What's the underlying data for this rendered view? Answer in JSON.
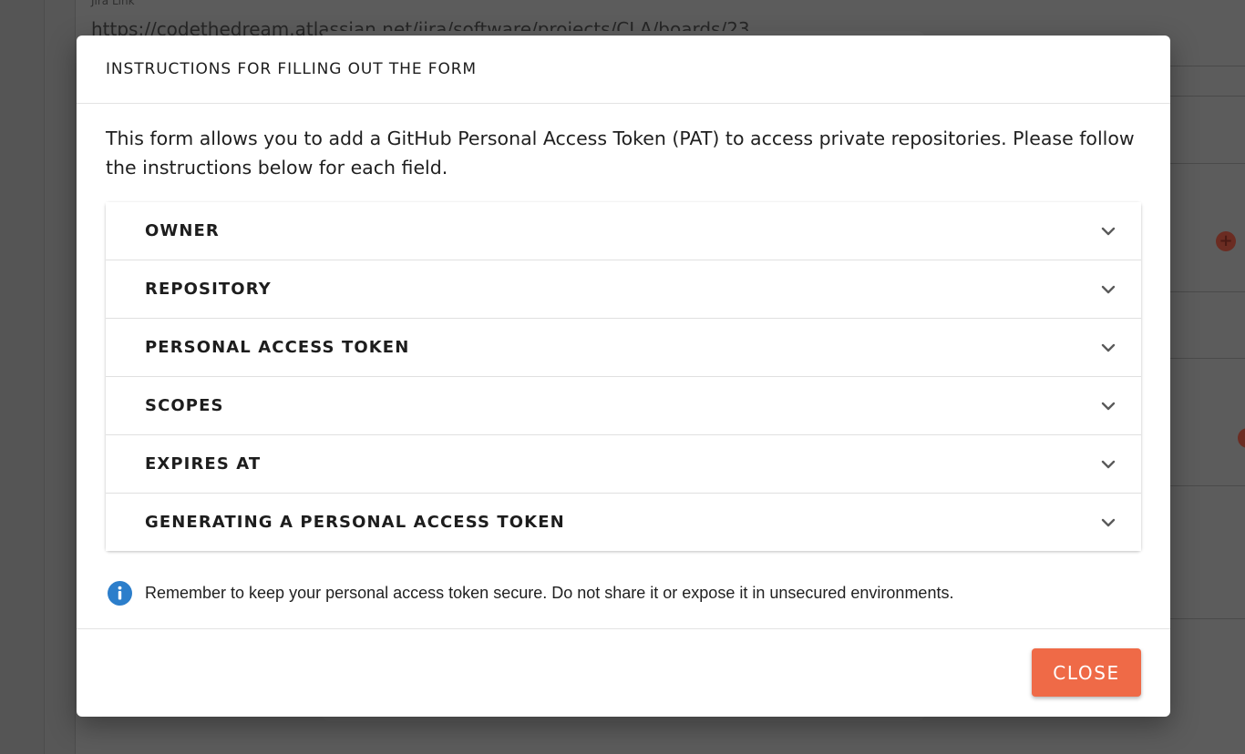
{
  "background": {
    "field_label": "Jira Link",
    "field_value": "https://codethedream.atlassian.net/jira/software/projects/CLA/boards/23"
  },
  "modal": {
    "title": "INSTRUCTIONS FOR FILLING OUT THE FORM",
    "intro": "This form allows you to add a GitHub Personal Access Token (PAT) to access private repositories. Please follow the instructions below for each field.",
    "sections": [
      {
        "label": "OWNER",
        "icon": "chevron-down-icon"
      },
      {
        "label": "REPOSITORY",
        "icon": "chevron-down-icon"
      },
      {
        "label": "PERSONAL ACCESS TOKEN",
        "icon": "chevron-down-icon"
      },
      {
        "label": "SCOPES",
        "icon": "chevron-down-icon"
      },
      {
        "label": "EXPIRES AT",
        "icon": "chevron-down-icon"
      },
      {
        "label": "GENERATING A PERSONAL ACCESS TOKEN",
        "icon": "chevron-down-icon"
      }
    ],
    "note": {
      "icon": "info-icon",
      "text": "Remember to keep your personal access token secure. Do not share it or expose it in unsecured environments."
    },
    "close_label": "CLOSE"
  },
  "colors": {
    "accent": "#ef6a47",
    "info": "#2c7ecb",
    "overlay": "#575757"
  }
}
